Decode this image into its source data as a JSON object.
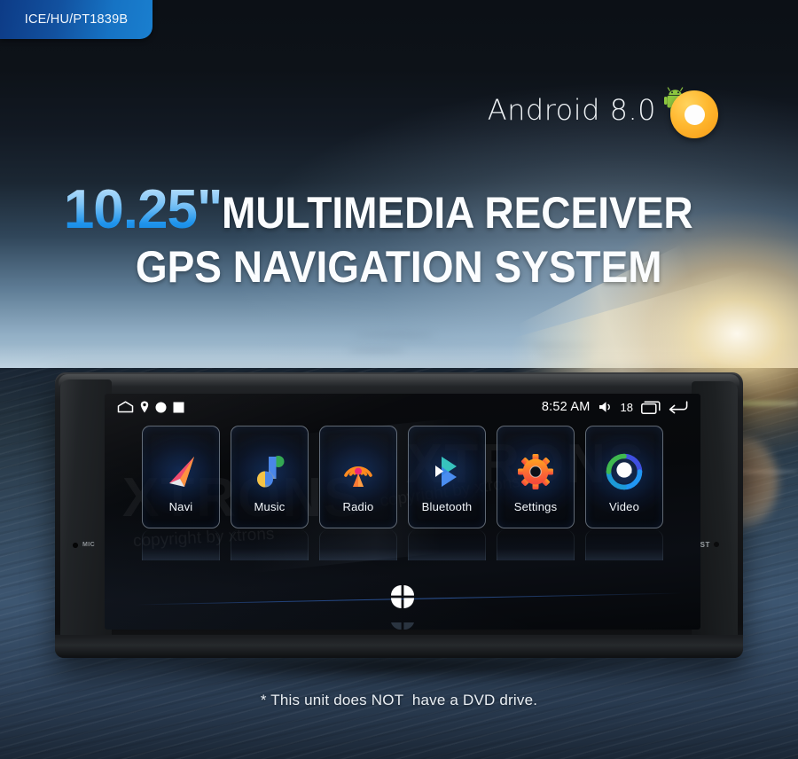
{
  "badge": {
    "label": "ICE/HU/PT1839B"
  },
  "android": {
    "label": "Android 8.0",
    "logo_icon": "android-oreo-logo",
    "ring_color": "#ffb830",
    "robot_color": "#8dc63f"
  },
  "headline": {
    "size": "10.25\"",
    "line1": "MULTIMEDIA RECEIVER",
    "line2": "GPS NAVIGATION SYSTEM",
    "size_color": "#1f94ec",
    "text_color": "#fbfdff"
  },
  "device": {
    "mic_label": "MIC",
    "reset_label": "RST",
    "lens_icon": "camera-lens",
    "screen": {
      "statusbar": {
        "home_icon": "home-icon",
        "notif_pin_icon": "location-pin-icon",
        "notif_circle_icon": "circle-icon",
        "notif_square_icon": "square-icon",
        "time": "8:52 AM",
        "volume_icon": "volume-icon",
        "volume_level": "18",
        "recents_icon": "recents-icon",
        "back_icon": "back-arrow-icon"
      },
      "apps": [
        {
          "label": "Navi",
          "icon": "navigation-arrow-icon"
        },
        {
          "label": "Music",
          "icon": "music-note-icon"
        },
        {
          "label": "Radio",
          "icon": "radio-tower-icon"
        },
        {
          "label": "Bluetooth",
          "icon": "bluetooth-icon"
        },
        {
          "label": "Settings",
          "icon": "gear-icon"
        },
        {
          "label": "Video",
          "icon": "video-play-icon"
        }
      ],
      "apps_grid_button_icon": "apps-grid-icon",
      "watermark_text": "XTRONS",
      "watermark_sub": "copyright by xtrons"
    }
  },
  "footer": {
    "note": "* This unit does NOT  have a DVD drive."
  }
}
